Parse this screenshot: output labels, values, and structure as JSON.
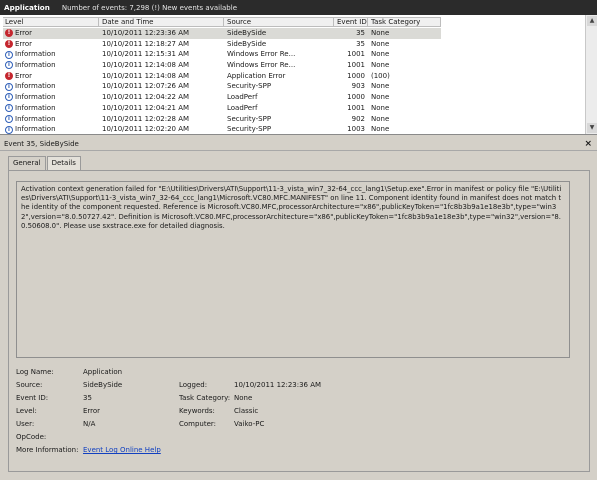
{
  "header": {
    "title": "Application",
    "event_count": "Number of events: 7,298 (!) New events available"
  },
  "list": {
    "columns": [
      "Level",
      "Date and Time",
      "Source",
      "Event ID",
      "Task Category"
    ],
    "rows": [
      {
        "level": "Error",
        "icon": "error-icon",
        "date": "10/10/2011 12:23:36 AM",
        "source": "SideBySide",
        "id": "35",
        "task": "None"
      },
      {
        "level": "Error",
        "icon": "error-icon",
        "date": "10/10/2011 12:18:27 AM",
        "source": "SideBySide",
        "id": "35",
        "task": "None"
      },
      {
        "level": "Information",
        "icon": "info-icon",
        "date": "10/10/2011 12:15:31 AM",
        "source": "Windows Error Re...",
        "id": "1001",
        "task": "None"
      },
      {
        "level": "Information",
        "icon": "info-icon",
        "date": "10/10/2011 12:14:08 AM",
        "source": "Windows Error Re...",
        "id": "1001",
        "task": "None"
      },
      {
        "level": "Error",
        "icon": "error-icon",
        "date": "10/10/2011 12:14:08 AM",
        "source": "Application Error",
        "id": "1000",
        "task": "(100)"
      },
      {
        "level": "Information",
        "icon": "info-icon",
        "date": "10/10/2011 12:07:26 AM",
        "source": "Security-SPP",
        "id": "903",
        "task": "None"
      },
      {
        "level": "Information",
        "icon": "info-icon",
        "date": "10/10/2011 12:04:22 AM",
        "source": "LoadPerf",
        "id": "1000",
        "task": "None"
      },
      {
        "level": "Information",
        "icon": "info-icon",
        "date": "10/10/2011 12:04:21 AM",
        "source": "LoadPerf",
        "id": "1001",
        "task": "None"
      },
      {
        "level": "Information",
        "icon": "info-icon",
        "date": "10/10/2011 12:02:28 AM",
        "source": "Security-SPP",
        "id": "902",
        "task": "None"
      },
      {
        "level": "Information",
        "icon": "info-icon",
        "date": "10/10/2011 12:02:20 AM",
        "source": "Security-SPP",
        "id": "1003",
        "task": "None"
      }
    ]
  },
  "detail": {
    "title": "Event 35, SideBySide",
    "close": "×",
    "tabs": [
      "General",
      "Details"
    ],
    "description": "Activation context generation failed for \"E:\\Utilities\\Drivers\\ATI\\Support\\11-3_vista_win7_32-64_ccc_lang1\\Setup.exe\".Error in manifest or policy file \"E:\\Utilities\\Drivers\\ATI\\Support\\11-3_vista_win7_32-64_ccc_lang1\\Microsoft.VC80.MFC.MANIFEST\" on line 11. Component identity found in manifest does not match the identity of the component requested. Reference is Microsoft.VC80.MFC,processorArchitecture=\"x86\",publicKeyToken=\"1fc8b3b9a1e18e3b\",type=\"win32\",version=\"8.0.50727.42\". Definition is Microsoft.VC80.MFC,processorArchitecture=\"x86\",publicKeyToken=\"1fc8b3b9a1e18e3b\",type=\"win32\",version=\"8.0.50608.0\". Please use sxstrace.exe for detailed diagnosis.",
    "props": {
      "log_name_label": "Log Name:",
      "log_name": "Application",
      "source_label": "Source:",
      "source": "SideBySide",
      "logged_label": "Logged:",
      "logged": "10/10/2011 12:23:36 AM",
      "event_id_label": "Event ID:",
      "event_id": "35",
      "task_label": "Task Category:",
      "task": "None",
      "level_label": "Level:",
      "level": "Error",
      "keywords_label": "Keywords:",
      "keywords": "Classic",
      "user_label": "User:",
      "user": "N/A",
      "computer_label": "Computer:",
      "computer": "Vaiko-PC",
      "opcode_label": "OpCode:",
      "more_info_label": "More Information:",
      "more_info_link": "Event Log Online Help"
    }
  }
}
